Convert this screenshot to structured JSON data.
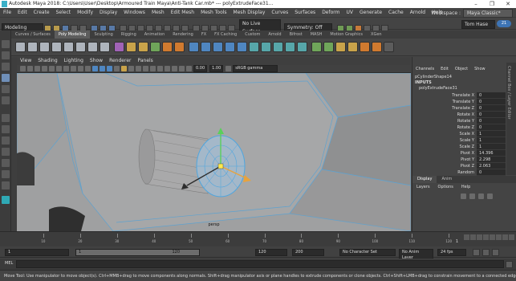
{
  "title": "Autodesk Maya 2018: C:\\Users\\User\\Desktop\\Armoured Train Maya\\Anti-Tank Car.mb* --- polyExtrudeFace31...",
  "window_controls": [
    "–",
    "❐",
    "✕"
  ],
  "menubar": {
    "items": [
      "File",
      "Edit",
      "Create",
      "Select",
      "Modify",
      "Display",
      "Windows",
      "Mesh",
      "Edit Mesh",
      "Mesh Tools",
      "Mesh Display",
      "Curves",
      "Surfaces",
      "Deform",
      "UV",
      "Generate",
      "Cache",
      "Arnold",
      "Help"
    ],
    "workspace_label": "Workspace :",
    "workspace_value": "Maya Classic*"
  },
  "statusline": {
    "mode": "Modeling",
    "live_surface": "No Live Surface",
    "symmetry": "Symmetry: Off",
    "user": "Tom Hase",
    "notifications": "21"
  },
  "shelf": {
    "tabs": [
      "Curves / Surfaces",
      "Poly Modeling",
      "Sculpting",
      "Rigging",
      "Animation",
      "Rendering",
      "FX",
      "FX Caching",
      "Custom",
      "Arnold",
      "Bifrost",
      "MASH",
      "Motion Graphics",
      "XGen"
    ],
    "active_tab": "Poly Modeling"
  },
  "panel": {
    "menu": [
      "View",
      "Shading",
      "Lighting",
      "Show",
      "Renderer",
      "Panels"
    ],
    "near_clip": "0.00",
    "far_clip": "1.00",
    "color_space": "sRGB gamma",
    "camera_label": "persp"
  },
  "channel_box": {
    "menu": [
      "Channels",
      "Edit",
      "Object",
      "Show"
    ],
    "shape_name": "pCylinderShape14",
    "inputs_label": "INPUTS",
    "node_name": "polyExtrudeFace31",
    "attributes": [
      {
        "name": "Translate X",
        "value": "0"
      },
      {
        "name": "Translate Y",
        "value": "0"
      },
      {
        "name": "Translate Z",
        "value": "0"
      },
      {
        "name": "Rotate X",
        "value": "0"
      },
      {
        "name": "Rotate Y",
        "value": "0"
      },
      {
        "name": "Rotate Z",
        "value": "0"
      },
      {
        "name": "Scale X",
        "value": "1"
      },
      {
        "name": "Scale Y",
        "value": "1"
      },
      {
        "name": "Scale Z",
        "value": "1"
      },
      {
        "name": "Pivot X",
        "value": "14.396"
      },
      {
        "name": "Pivot Y",
        "value": "2.298"
      },
      {
        "name": "Pivot Z",
        "value": "2.063"
      },
      {
        "name": "Random",
        "value": "0"
      }
    ],
    "layer_tabs": [
      "Display",
      "Anim"
    ],
    "layer_menu": [
      "Layers",
      "Options",
      "Help"
    ],
    "side_strip": "Channel Box / Layer Editor"
  },
  "timeline": {
    "ticks": [
      "10",
      "20",
      "30",
      "40",
      "50",
      "60",
      "70",
      "80",
      "90",
      "100",
      "110",
      "120"
    ],
    "current_frame": "1"
  },
  "range": {
    "start": "1",
    "playback_start": "1",
    "slider_end": "120",
    "playback_end": "120",
    "end": "200",
    "character_set": "No Character Set",
    "anim_layer": "No Anim Layer",
    "fps": "24 fps"
  },
  "command_line": {
    "label": "MEL"
  },
  "help_line": "Move Tool: Use manipulator to move object(s). Ctrl+MMB+drag to move components along normals. Shift+drag manipulator axis or plane handles to extrude components or clone objects. Ctrl+Shift+LMB+drag to constrain movement to a connected edge. Use D or INSERT to change the pivot position"
}
